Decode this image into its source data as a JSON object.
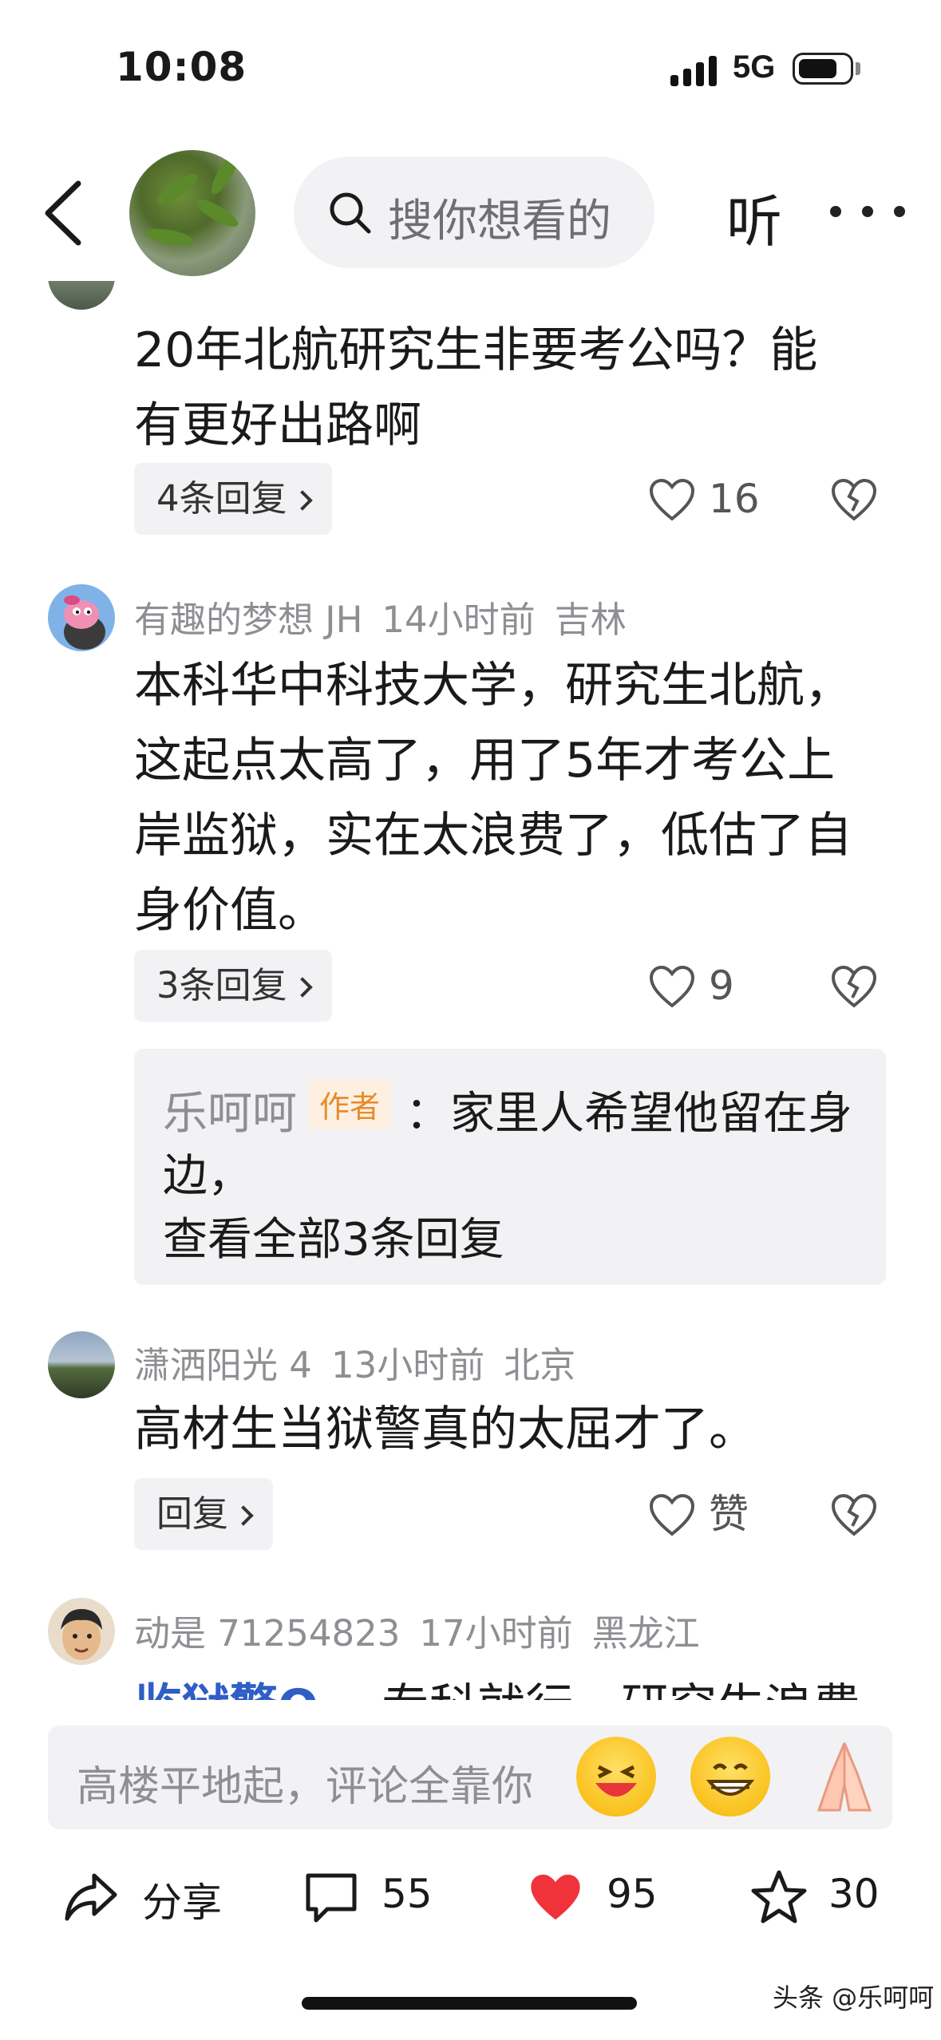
{
  "status_bar": {
    "time": "10:08",
    "network": "5G",
    "battery_level": 0.75
  },
  "header": {
    "search_placeholder": "搜你想看的",
    "listen_label": "听"
  },
  "comments": [
    {
      "text_lines": [
        "20年北航研究生非要考公吗？能",
        "有更好出路啊"
      ],
      "reply_chip": "4条回复",
      "likes": "16"
    },
    {
      "author": "有趣的梦想 JH",
      "time": "14小时前",
      "location": "吉林",
      "text_lines": [
        "本科华中科技大学，研究生北航，",
        "这起点太高了，用了5年才考公上",
        "岸监狱，实在太浪费了，低估了自",
        "身价值。"
      ],
      "reply_chip": "3条回复",
      "likes": "9",
      "author_reply": {
        "author": "乐呵呵",
        "badge": "作者",
        "text_line1": "：家里人希望他留在身",
        "text_line2": "边，",
        "view_all": "查看全部3条回复"
      }
    },
    {
      "author": "潇洒阳光 4",
      "time": "13小时前",
      "location": "北京",
      "text_lines": [
        "高材生当狱警真的太屈才了。"
      ],
      "reply_chip": "回复",
      "likes": "赞"
    },
    {
      "author": "动是 71254823",
      "time": "17小时前",
      "location": "黑龙江",
      "partial_tag": "监狱警Q",
      "partial_text": "专科就行，研究生浪费"
    }
  ],
  "comment_input": {
    "placeholder": "高楼平地起，评论全靠你"
  },
  "bottom_bar": {
    "share_label": "分享",
    "comments_count": "55",
    "likes_count": "95",
    "favorites_count": "30"
  },
  "watermark": "头条 @乐呵呵",
  "colors": {
    "like_red": "#f0333a",
    "author_badge": "#e88b2c",
    "link_blue": "#2f5ec6"
  }
}
